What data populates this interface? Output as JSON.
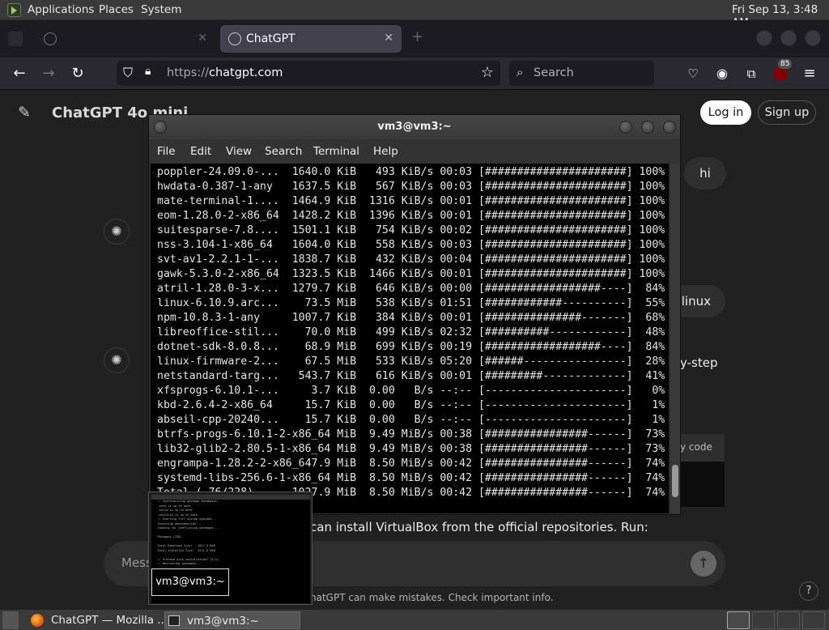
{
  "top_panel": {
    "menu": [
      "Applications",
      "Places",
      "System"
    ],
    "clock": "Fri Sep 13,  3:48 AM"
  },
  "browser": {
    "tabs": [
      {
        "label": "",
        "active": false
      },
      {
        "label": "ChatGPT",
        "active": true
      }
    ],
    "url_protocol": "https://",
    "url_host": "chatgpt.com",
    "search_placeholder": "Search",
    "extension_badge": "85"
  },
  "chatgpt": {
    "model_title": "ChatGPT 4o mini",
    "login_label": "Log in",
    "signup_label": "Sign up",
    "user_message": "hi",
    "fragment_linux": "linux",
    "fragment_step": "y-step",
    "fragment_code": "y code",
    "install_text": "can install VirtualBox from the official repositories. Run:",
    "composer_placeholder": "Mess",
    "disclaimer": "hatGPT can make mistakes. Check important info.",
    "help": "?"
  },
  "terminal": {
    "title": "vm3@vm3:~",
    "menu": [
      "File",
      "Edit",
      "View",
      "Search",
      "Terminal",
      "Help"
    ],
    "lines": [
      "poppler-24.09.0-...  1640.0 KiB   493 KiB/s 00:03 [######################] 100%",
      "hwdata-0.387-1-any   1637.5 KiB   567 KiB/s 00:03 [######################] 100%",
      "mate-terminal-1....  1464.9 KiB  1316 KiB/s 00:01 [######################] 100%",
      "eom-1.28.0-2-x86_64  1428.2 KiB  1396 KiB/s 00:01 [######################] 100%",
      "suitesparse-7.8....  1501.1 KiB   754 KiB/s 00:02 [######################] 100%",
      "nss-3.104-1-x86_64   1604.0 KiB   558 KiB/s 00:03 [######################] 100%",
      "svt-av1-2.2.1-1-...  1838.7 KiB   432 KiB/s 00:04 [######################] 100%",
      "gawk-5.3.0-2-x86_64  1323.5 KiB  1466 KiB/s 00:01 [######################] 100%",
      "atril-1.28.0-3-x...  1279.7 KiB   646 KiB/s 00:00 [##################----]  84%",
      "linux-6.10.9.arc...    73.5 MiB   538 KiB/s 01:51 [############----------]  55%",
      "npm-10.8.3-1-any     1007.7 KiB   384 KiB/s 00:01 [###############-------]  68%",
      "libreoffice-stil...    70.0 MiB   499 KiB/s 02:32 [##########------------]  48%",
      "dotnet-sdk-8.0.8...    68.9 MiB   699 KiB/s 00:19 [##################----]  84%",
      "linux-firmware-2...    67.5 MiB   533 KiB/s 05:20 [######----------------]  28%",
      "netstandard-targ...   543.7 KiB   616 KiB/s 00:01 [#########-------------]  41%",
      "xfsprogs-6.10.1-...     3.7 KiB  0.00   B/s --:-- [----------------------]   0%",
      "kbd-2.6.4-2-x86_64     15.7 KiB  0.00   B/s --:-- [----------------------]   1%",
      "abseil-cpp-20240...    15.7 KiB  0.00   B/s --:-- [----------------------]   1%",
      "btrfs-progs-6.10.1-2-x86_64 MiB  9.49 MiB/s 00:38 [################------]  73%",
      "lib32-glib2-2.80.5-1-x86_64 MiB  9.49 MiB/s 00:38 [################------]  73%",
      "engrampa-1.28.2-2-x86_647.9 MiB  8.50 MiB/s 00:42 [################------]  74%",
      "systemd-libs-256.6-1-x86_64 MiB  8.50 MiB/s 00:42 [################------]  74%",
      "Total ( 76/228)      1027.9 MiB  8.50 MiB/s 00:42 [################------]  74%"
    ]
  },
  "preview": {
    "label": "vm3@vm3:~"
  },
  "taskbar": {
    "items": [
      "ChatGPT — Mozilla ...",
      "vm3@vm3:~"
    ]
  }
}
